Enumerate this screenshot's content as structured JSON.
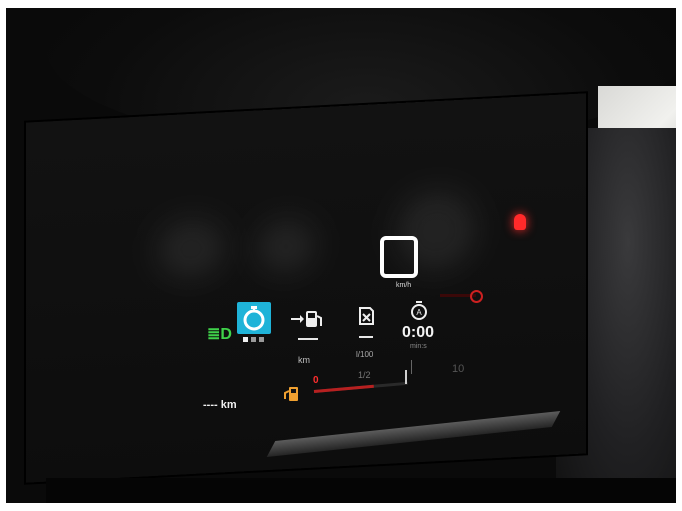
{
  "cluster": {
    "speed_unit": "km/h",
    "trip_range_value": "----",
    "trip_range_unit": "km",
    "consumption_value": "---",
    "consumption_unit": "l/100",
    "elapsed_time": "0:00",
    "elapsed_time_unit": "min:s",
    "range_to_empty": "---- km",
    "fuel_low_mark": "0",
    "fuel_half_mark": "1/2",
    "right_scale_label": "10"
  },
  "colors": {
    "headlight_indicator": "#3fd24a",
    "selected_tile": "#1fb3d8",
    "warning_red": "#ff2a2a",
    "fuel_pump_icon": "#f0a030"
  },
  "icons": [
    "low-beam-headlight-icon",
    "stopwatch-icon",
    "fuel-range-icon",
    "fuel-consumption-icon",
    "trip-timer-icon",
    "fuel-pump-icon",
    "warning-light-icon"
  ],
  "carousel": {
    "page_count": 3,
    "active_page": 1
  },
  "fuel_level": 0.65
}
